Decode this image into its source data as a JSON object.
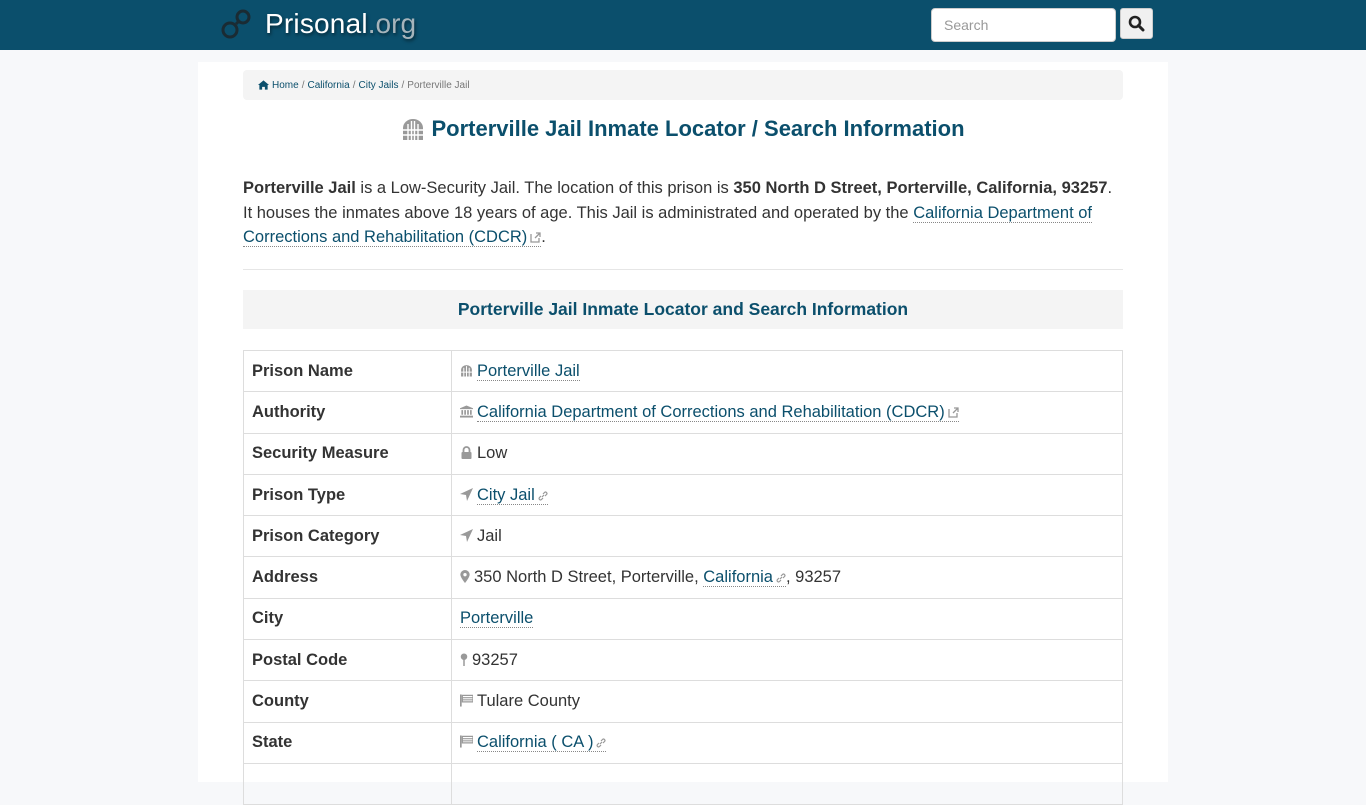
{
  "header": {
    "brand_name": "Prisonal",
    "brand_tld": ".org",
    "search_placeholder": "Search",
    "colors": {
      "header_bg": "#0b4f6c",
      "link": "#0b4f6c"
    }
  },
  "breadcrumb": {
    "items": [
      "Home",
      "California",
      "City Jails"
    ],
    "separator": "/",
    "current": "Porterville Jail"
  },
  "page": {
    "title": "Porterville Jail Inmate Locator / Search Information",
    "intro": {
      "name": "Porterville Jail",
      "t1": " is a Low-Security Jail. The location of this prison is ",
      "address": "350 North D Street, Porterville, California, 93257",
      "t2": ". It houses the inmates above 18 years of age. This Jail is administrated and operated by the ",
      "authority_link": "California Department of Corrections and Rehabilitation (CDCR)",
      "t3": "."
    },
    "section_title": "Porterville Jail Inmate Locator and Search Information"
  },
  "table": {
    "rows": [
      {
        "key": "Prison Name",
        "value": "Porterville Jail"
      },
      {
        "key": "Authority",
        "value": "California Department of Corrections and Rehabilitation (CDCR)"
      },
      {
        "key": "Security Measure",
        "value": "Low"
      },
      {
        "key": "Prison Type",
        "value": "City Jail"
      },
      {
        "key": "Prison Category",
        "value": "Jail"
      },
      {
        "key": "Address",
        "value_pre": "350 North D Street, Porterville, ",
        "value_link": "California",
        "value_post": ", 93257"
      },
      {
        "key": "City",
        "value": "Porterville"
      },
      {
        "key": "Postal Code",
        "value": "93257"
      },
      {
        "key": "County",
        "value": "Tulare County"
      },
      {
        "key": "State",
        "value": "California ( CA )"
      }
    ]
  }
}
